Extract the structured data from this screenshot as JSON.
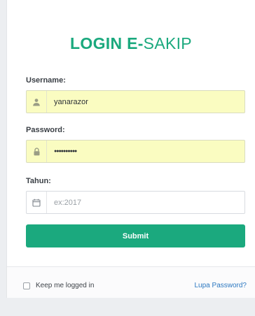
{
  "header": {
    "title_bold": "LOGIN E-",
    "title_light": "SAKIP"
  },
  "form": {
    "username": {
      "label": "Username:",
      "value": "yanarazor",
      "icon": "user-icon"
    },
    "password": {
      "label": "Password:",
      "value": "●●●●●●●●●●",
      "icon": "lock-icon"
    },
    "tahun": {
      "label": "Tahun:",
      "placeholder": "ex:2017",
      "icon": "calendar-icon"
    },
    "submit_label": "Submit"
  },
  "footer": {
    "remember_label": "Keep me logged in",
    "forgot_label": "Lupa Password?"
  },
  "colors": {
    "accent": "#1ba97e",
    "autofill": "#fafcc1",
    "link": "#2d79c1"
  }
}
